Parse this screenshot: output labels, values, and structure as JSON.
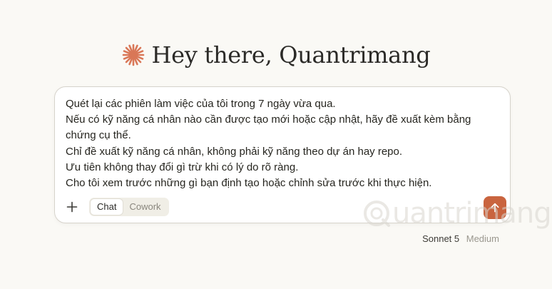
{
  "greeting": {
    "icon": "asterisk-spark-icon",
    "text": "Hey there, Quantrimang"
  },
  "composer": {
    "prompt_lines": [
      "Quét lại các phiên làm việc của tôi trong 7 ngày vừa qua.",
      "Nếu có kỹ năng cá nhân nào cần được tạo mới hoặc cập nhật, hãy đề xuất kèm bằng chứng cụ thể.",
      "Chỉ đề xuất kỹ năng cá nhân, không phải kỹ năng theo dự án hay repo.",
      "Ưu tiên không thay đổi gì trừ khi có lý do rõ ràng.",
      "Cho tôi xem trước những gì bạn định tạo hoặc chỉnh sửa trước khi thực hiện."
    ],
    "add_icon": "plus-icon",
    "modes": [
      {
        "label": "Chat",
        "active": true
      },
      {
        "label": "Cowork",
        "active": false
      }
    ],
    "send_icon": "arrow-up-icon"
  },
  "model": {
    "name": "Sonnet 5",
    "effort": "Medium"
  },
  "watermark": {
    "text": "uantrimang"
  },
  "colors": {
    "background": "#faf9f5",
    "accent": "#c9643f",
    "spark": "#d97757"
  }
}
